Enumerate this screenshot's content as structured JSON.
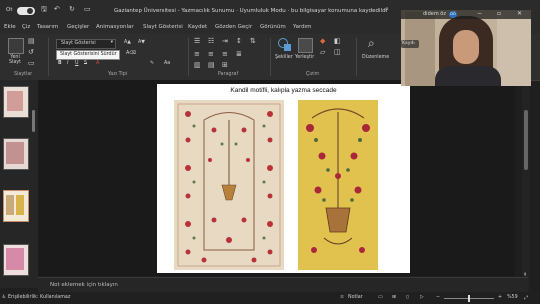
{
  "titlebar": {
    "autosave_label": "Ot",
    "title": "Gaziantep Üniversitesi - Yazmacılık Sunumu · Uyumluluk Modu · bu bilgisayar konumuna kaydedildi",
    "user_name": "didem öz",
    "user_initials": "DÖ"
  },
  "menu": {
    "items": [
      "Ekle",
      "Çiz",
      "Tasarım",
      "Geçişler",
      "Animasyonlar",
      "Slayt Gösterisi",
      "Kaydet",
      "Gözden Geçir",
      "Görünüm",
      "Yardım"
    ],
    "share_label": "Kaydı"
  },
  "ribbon": {
    "new_slide_label": "Yeni Slayt",
    "font_name_value": "Slayt Gösterisi",
    "font_tooltip": "Slayt Gösterisini Sürdür",
    "groups": {
      "slides": "Slaytlar",
      "font": "Yazı Tipi",
      "paragraph": "Paragraf",
      "drawing": "Çizim"
    },
    "shapes_label": "Şekiller",
    "arrange_label": "Yerleştir",
    "editing_label": "Düzenleme"
  },
  "slide": {
    "title": "Kandil motifli, kalıpla yazma seccade"
  },
  "notes": {
    "placeholder": "Not eklemek için tıklayın"
  },
  "statusbar": {
    "accessibility": "Erişilebilirlik: Kullanılamaz",
    "notes_label": "Notlar",
    "zoom": "%59"
  },
  "colors": {
    "accent": "#c43e1c",
    "titlebar_bg": "#2b2b2b",
    "canvas_bg": "#1a1a1a",
    "slide_bg": "#ffffff"
  }
}
